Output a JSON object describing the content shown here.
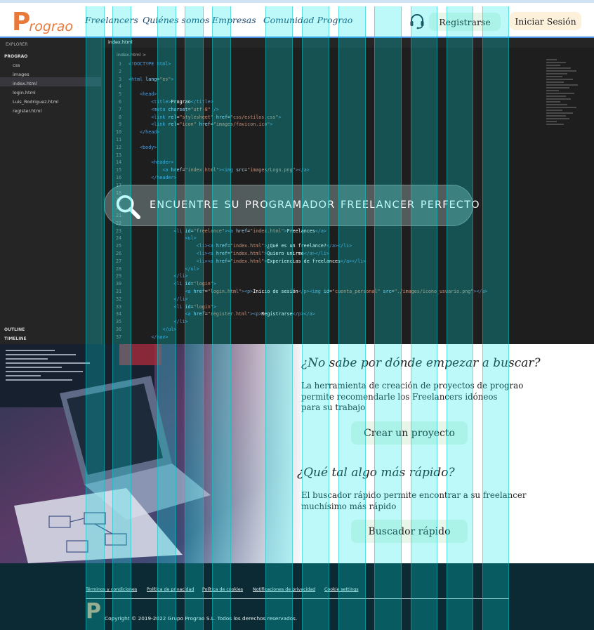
{
  "header": {
    "logo_text": "Prograo",
    "nav": [
      "Freelancers",
      "Quiénes somos",
      "Empresas",
      "Comunidad Prograo"
    ],
    "support_icon": "headset-icon",
    "register_label": "Registrarse",
    "login_label": "Iniciar Sesión"
  },
  "editor": {
    "explorer_label": "EXPLORER",
    "project": "PROGRAO",
    "files": [
      "css",
      "images",
      "index.html",
      "login.html",
      "Luis_Rodriguez.html",
      "register.html"
    ],
    "active_tab": "index.html",
    "breadcrumb": "index.html >",
    "outline_label": "OUTLINE",
    "timeline_label": "TIMELINE"
  },
  "hero": {
    "search_text": "ENCUENTRE SU PROGRAMADOR FREELANCER PERFECTO",
    "search_icon": "search-icon"
  },
  "promo": {
    "q1_title": "¿No sabe por dónde empezar a buscar?",
    "q1_lines": [
      "La herramienta de creación de proyectos de prograo",
      "permite recomendarle los Freelancers idóneos",
      "para su trabajo"
    ],
    "q1_button": "Crear un proyecto",
    "q2_title": "¿Qué tal algo más rápido?",
    "q2_lines": [
      "El buscador rápido permite encontrar a su freelancer",
      "muchísimo más rápido"
    ],
    "q2_button": "Buscador rápido"
  },
  "footer": {
    "links": [
      "Términos y condiciones",
      "Política de privacidad",
      "Política de cookies",
      "Notificaciones de privacidad",
      "Cookie settings"
    ],
    "logo_letter": "P",
    "copyright": "Copyright © 2019-2022 Grupo Prograo S.L. Todos los derechos reservados."
  },
  "colors": {
    "brand_orange": "#e8793a",
    "register_bg": "#e7f6e9",
    "login_bg": "#fdf1dc",
    "footer_bg": "#0b2a33",
    "grid_overlay": "#00e6e6"
  }
}
